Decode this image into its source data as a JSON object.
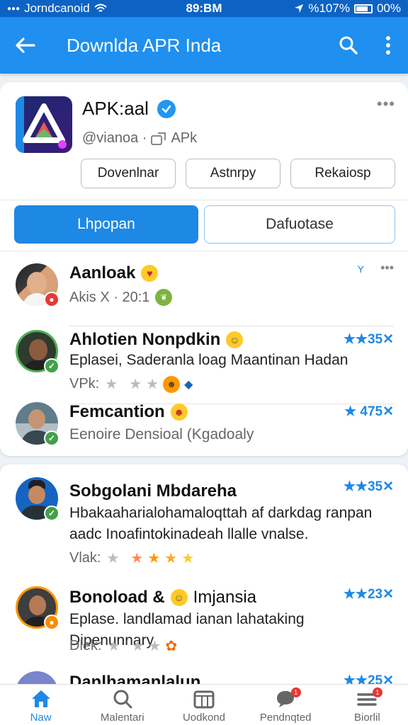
{
  "status_bar": {
    "left_text": "Jorndcanoid",
    "time": "89:BM",
    "battery": "%107%",
    "right_text": "00%"
  },
  "appbar": {
    "title": "Downlda APR Inda"
  },
  "app": {
    "name": "APK:aal",
    "handle": "@vianoa ·",
    "type_label": "APk",
    "buttons": [
      "Dovenlnar",
      "Astnrpy",
      "Rekaiosp"
    ]
  },
  "tabs": {
    "active": "Lhpopan",
    "inactive": "Dafuotase"
  },
  "reviews": [
    {
      "name": "Aanloak",
      "text": "",
      "meta": "Akis X · 20:1",
      "rating": "",
      "stars": 0,
      "avatar_colors": [
        "#2b2b2b",
        "#d8a27c"
      ],
      "badge_color": "#e53935"
    },
    {
      "name": "Ahlotien Nonpdkin",
      "text": "Eplasei, Saderanla loag Maantinan Hadan",
      "meta": "VPk:",
      "rating": "★★35✕",
      "stars": 3,
      "avatar_colors": [
        "#4caf50",
        "#6d4c41"
      ],
      "badge_color": "#43a047"
    },
    {
      "name": "Femcantion",
      "text": "Eenoire Densioal (Kgadoaly",
      "meta": "",
      "rating": "★ 475✕",
      "stars": 0,
      "avatar_colors": [
        "#b0bec5",
        "#5d4037"
      ],
      "badge_color": "#43a047"
    },
    {
      "name": "Sobgolani Mbdareha",
      "text": "Hbakaaharialohamaloqttah af darkdag ranpan aadc Inoafintokinadeah llalle vnalse.",
      "meta": "Vlak:",
      "rating": "★★35✕",
      "stars": 4,
      "avatar_colors": [
        "#1565c0",
        "#3e2723"
      ],
      "badge_color": "#43a047"
    },
    {
      "name": "Bonoload & ",
      "name_suffix": "Imjansia",
      "text": "Eplase. landlamad ianan lahataking Dipenunnary",
      "meta": "Dlek:",
      "rating": "★★23✕",
      "stars": 3,
      "avatar_colors": [
        "#ff9800",
        "#4e342e"
      ],
      "badge_color": "#fb8c00"
    },
    {
      "name": "Danlhamanlalun",
      "text": "",
      "meta": "",
      "rating": "★★25✕",
      "stars": 0,
      "avatar_colors": [
        "#7986cb",
        "#3e2723"
      ],
      "badge_color": "#43a047"
    }
  ],
  "bottom_nav": [
    {
      "label": "Naw",
      "icon": "home-icon",
      "active": true
    },
    {
      "label": "Malentari",
      "icon": "search-icon",
      "active": false
    },
    {
      "label": "Uodkond",
      "icon": "library-icon",
      "active": false
    },
    {
      "label": "Pendnqted",
      "icon": "chat-icon",
      "active": false,
      "badge": "1"
    },
    {
      "label": "Biorlil",
      "icon": "menu-icon",
      "active": false,
      "badge": "1"
    }
  ],
  "colors": {
    "accent": "#1e88e5",
    "appbar": "#1f8ff0",
    "status": "#0d63c4"
  }
}
